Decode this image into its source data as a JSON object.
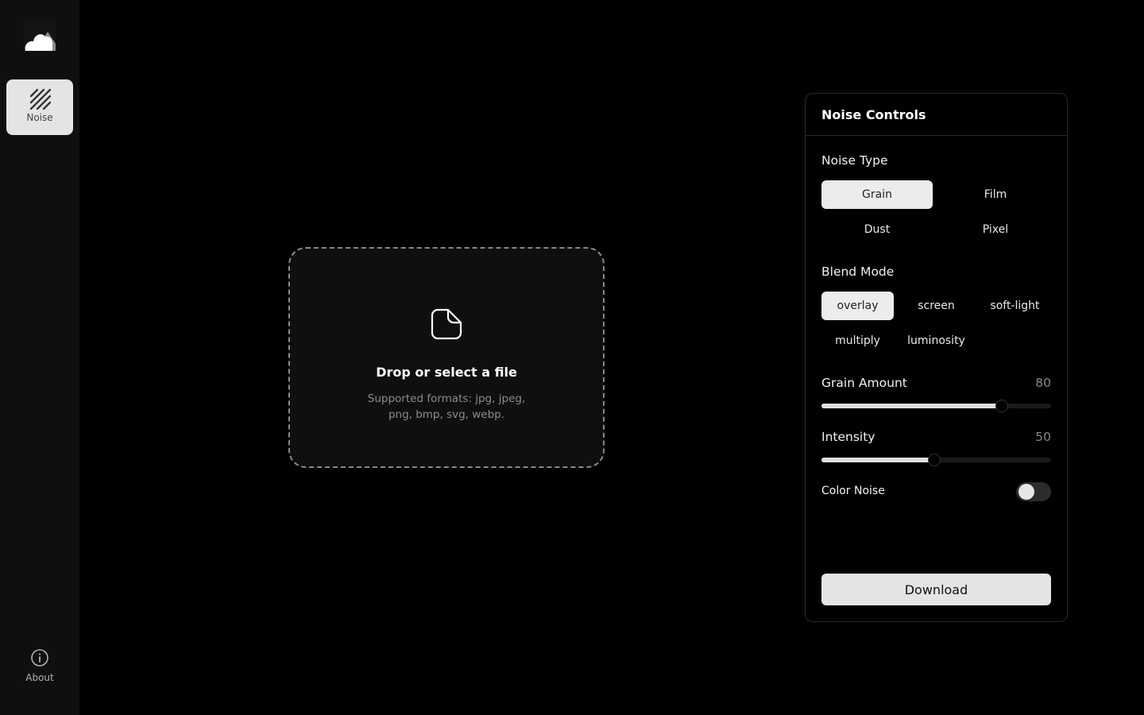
{
  "sidebar": {
    "logo_icon": "cloud-icon",
    "items": [
      {
        "label": "Noise",
        "icon": "noise-lines-icon",
        "active": true
      }
    ],
    "footer": {
      "label": "About",
      "icon": "info-icon"
    }
  },
  "dropzone": {
    "icon": "file-icon",
    "title": "Drop or select a file",
    "subtitle": "Supported formats: jpg, jpeg, png, bmp, svg, webp."
  },
  "panel": {
    "title": "Noise Controls",
    "noise_type": {
      "label": "Noise Type",
      "options": [
        "Grain",
        "Film",
        "Dust",
        "Pixel"
      ],
      "selected": "Grain"
    },
    "blend_mode": {
      "label": "Blend Mode",
      "options": [
        "overlay",
        "screen",
        "soft-light",
        "multiply",
        "luminosity"
      ],
      "selected": "overlay"
    },
    "grain_amount": {
      "label": "Grain Amount",
      "value": "80",
      "max": 100
    },
    "intensity": {
      "label": "Intensity",
      "value": "50",
      "max": 100
    },
    "color_noise": {
      "label": "Color Noise",
      "enabled": false
    },
    "download_label": "Download"
  },
  "colors": {
    "background": "#000000",
    "sidebar": "#0f0f10",
    "active": "#e4e4e4",
    "muted_text": "#888888"
  }
}
